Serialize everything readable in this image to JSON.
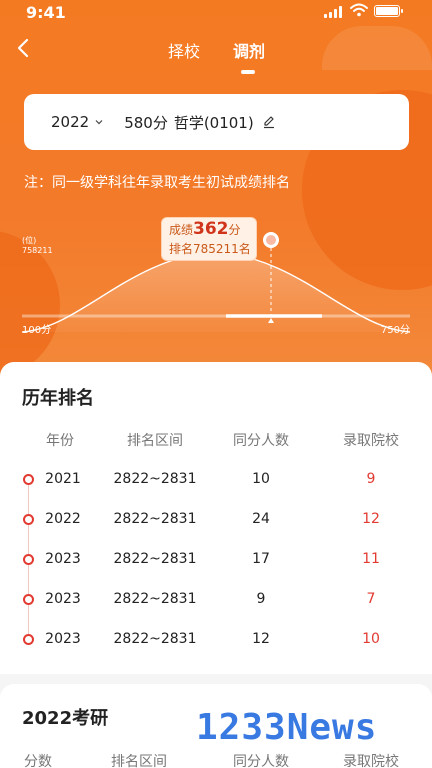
{
  "status_bar": {
    "time": "9:41"
  },
  "nav": {
    "tabs": [
      {
        "label": "择校"
      },
      {
        "label": "调剂"
      }
    ],
    "active_tab": "调剂"
  },
  "selector": {
    "year": "2022",
    "score": "580分",
    "subject": "哲学(0101)"
  },
  "note": "注：同一级学科往年录取考生初试成绩排名",
  "distribution": {
    "rank_axis_unit": "(位)",
    "rank_axis_value": "758211",
    "score_prefix": "成绩",
    "score_value": "362",
    "score_suffix": "分",
    "rank_text": "排名785211名",
    "min_label": "100分",
    "max_label": "750分"
  },
  "history": {
    "title": "历年排名",
    "columns": [
      "年份",
      "排名区间",
      "同分人数",
      "录取院校"
    ],
    "rows": [
      {
        "year": "2021",
        "range": "2822~2831",
        "count": "10",
        "schools": "9"
      },
      {
        "year": "2022",
        "range": "2822~2831",
        "count": "24",
        "schools": "12"
      },
      {
        "year": "2023",
        "range": "2822~2831",
        "count": "17",
        "schools": "11"
      },
      {
        "year": "2023",
        "range": "2822~2831",
        "count": "9",
        "schools": "7"
      },
      {
        "year": "2023",
        "range": "2822~2831",
        "count": "12",
        "schools": "10"
      }
    ]
  },
  "exam2022": {
    "title": "2022考研",
    "columns": [
      "分数",
      "排名区间",
      "同分人数",
      "录取院校"
    ]
  },
  "watermark": "1233News",
  "colors": {
    "primary": "#f37a2a",
    "accent_red": "#e23a31"
  }
}
